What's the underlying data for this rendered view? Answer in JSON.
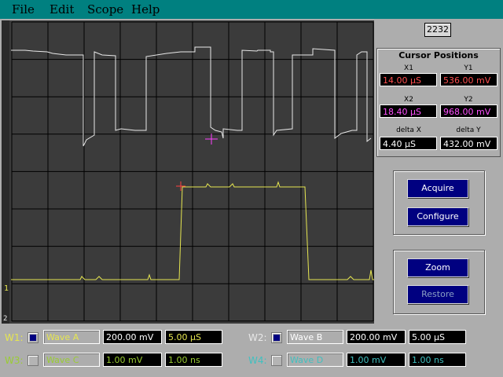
{
  "menu": {
    "file": "File",
    "edit": "Edit",
    "scope": "Scope",
    "help": "Help"
  },
  "counter": "2232",
  "cursor_panel": {
    "title": "Cursor Positions",
    "x1_label": "X1",
    "x1": "14.00 μS",
    "y1_label": "Y1",
    "y1": "536.00 mV",
    "x2_label": "X2",
    "x2": "18.40 μS",
    "y2_label": "Y2",
    "y2": "968.00 mV",
    "dx_label": "delta X",
    "dx": "4.40 μS",
    "dy_label": "delta Y",
    "dy": "432.00 mV"
  },
  "buttons": {
    "acquire": "Acquire",
    "configure": "Configure",
    "zoom": "Zoom",
    "restore": "Restore"
  },
  "scope": {
    "marker_ch1": "1",
    "marker_ch2": "2"
  },
  "waves": {
    "w1": {
      "label": "W1:",
      "name": "Wave A",
      "volts": "200.00 mV",
      "time": "5.00 μS",
      "checked": true
    },
    "w2": {
      "label": "W2:",
      "name": "Wave B",
      "volts": "200.00 mV",
      "time": "5.00 μS",
      "checked": true
    },
    "w3": {
      "label": "W3:",
      "name": "Wave C",
      "volts": "1.00 mV",
      "time": "1.00 ns",
      "checked": false
    },
    "w4": {
      "label": "W4:",
      "name": "Wave D",
      "volts": "1.00 mV",
      "time": "1.00 ns",
      "checked": false
    }
  },
  "colors": {
    "menubar": "#008080",
    "screen": "#3b3b3b",
    "grid": "#000000",
    "trace_white": "#e8e8e8",
    "trace_yellow": "#e6e650",
    "cursor1": "#ff4040",
    "cursor2": "#ff40ff",
    "w3_w4_label": "#40c0c0"
  }
}
